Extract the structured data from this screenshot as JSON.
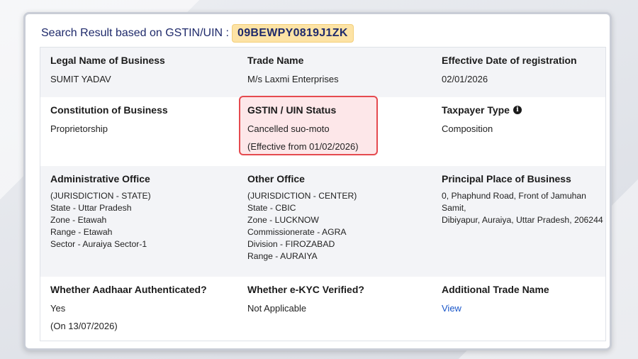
{
  "header": {
    "search_label": "Search Result based on GSTIN/UIN :",
    "gstin": "09BEWPY0819J1ZK"
  },
  "details": {
    "legal_name": {
      "label": "Legal Name of Business",
      "value": "SUMIT YADAV"
    },
    "trade_name": {
      "label": "Trade Name",
      "value": "M/s Laxmi Enterprises"
    },
    "effective_date": {
      "label": "Effective Date of registration",
      "value": "02/01/2026"
    },
    "constitution": {
      "label": "Constitution of Business",
      "value": "Proprietorship"
    },
    "status": {
      "label": "GSTIN / UIN Status",
      "value": "Cancelled suo-moto",
      "effective": "(Effective from 01/02/2026)"
    },
    "taxpayer_type": {
      "label": "Taxpayer Type",
      "value": "Composition",
      "icon": "info-icon"
    },
    "admin_office": {
      "label": "Administrative Office",
      "lines": [
        "(JURISDICTION - STATE)",
        "State - Uttar Pradesh",
        "Zone - Etawah",
        "Range - Etawah",
        "Sector - Auraiya Sector-1"
      ]
    },
    "other_office": {
      "label": "Other Office",
      "lines": [
        "(JURISDICTION - CENTER)",
        "State - CBIC",
        "Zone - LUCKNOW",
        "Commissionerate - AGRA",
        "Division - FIROZABAD",
        "Range - AURAIYA"
      ]
    },
    "principal_place": {
      "label": "Principal Place of Business",
      "lines": [
        "0, Phaphund Road, Front of Jamuhan Samit,",
        "Dibiyapur, Auraiya, Uttar Pradesh, 206244"
      ]
    },
    "aadhaar": {
      "label": "Whether Aadhaar Authenticated?",
      "value": "Yes",
      "date": "(On 13/07/2026)"
    },
    "ekyc": {
      "label": "Whether e-KYC Verified?",
      "value": "Not Applicable"
    },
    "additional_trade": {
      "label": "Additional Trade Name",
      "link": "View"
    }
  },
  "colors": {
    "header_text": "#1f2a6b",
    "gstin_highlight": "#fde3a5",
    "status_border": "#e54a4f",
    "status_fill": "#fde7e9",
    "link": "#1a57c9"
  }
}
